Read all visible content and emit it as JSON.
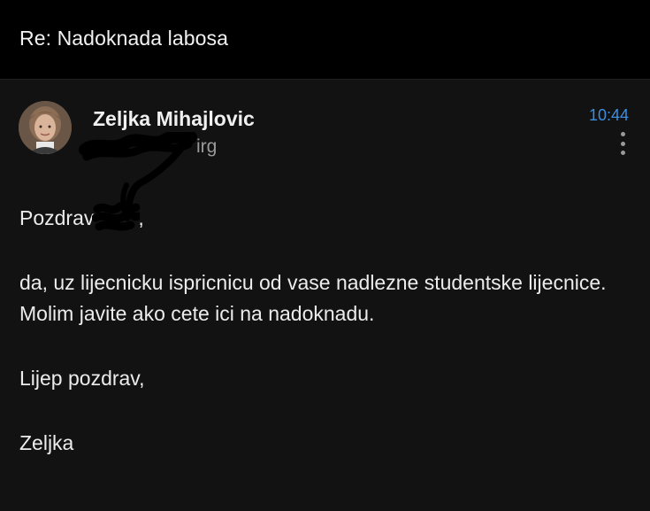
{
  "email": {
    "subject": "Re: Nadoknada labosa",
    "sender_name": "Zeljka Mihajlovic",
    "recipient_visible": "irg",
    "time": "10:44",
    "body": {
      "greeting_prefix": "Pozdrav",
      "greeting_suffix": ",",
      "line1": "da, uz lijecnicku ispricnicu od vase nadlezne studentske lijecnice.",
      "line2": "Molim javite ako cete ici na nadoknadu.",
      "closing": "Lijep pozdrav,",
      "signature": "Zeljka"
    }
  },
  "colors": {
    "background": "#121212",
    "topbar": "#000000",
    "accent_time": "#3d8ee0",
    "muted": "#9a9a9a"
  },
  "icons": {
    "more": "more-vertical-icon",
    "avatar": "sender-avatar"
  }
}
